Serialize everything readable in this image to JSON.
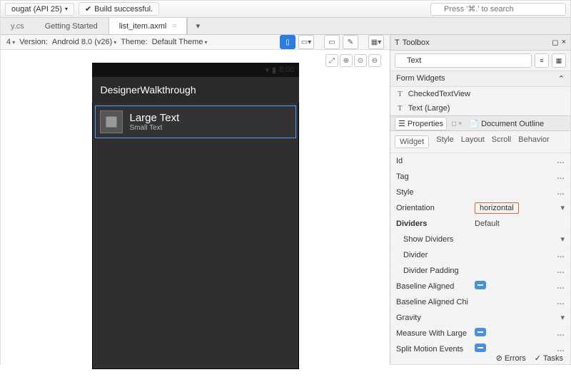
{
  "top": {
    "target": "ougat (API 25)",
    "build": "Build successful.",
    "search_ph": "Press '⌘.' to search"
  },
  "tabs": {
    "file0": "y.cs",
    "file1": "Getting Started",
    "file2": "list_item.axml"
  },
  "toolbar": {
    "seg0": "4",
    "version_lbl": "Version:",
    "version": "Android 8.0 (v26)",
    "theme_lbl": "Theme:",
    "theme": "Default Theme"
  },
  "device": {
    "time": "8:00",
    "app": "DesignerWalkthrough",
    "large": "Large Text",
    "small": "Small Text"
  },
  "toolbox": {
    "title": "Toolbox",
    "query": "Text",
    "cat": "Form Widgets",
    "items": [
      "CheckedTextView",
      "Text (Large)"
    ]
  },
  "props": {
    "title": "Properties",
    "outline": "Document Outline",
    "tabs": [
      "Widget",
      "Style",
      "Layout",
      "Scroll",
      "Behavior"
    ],
    "rows": [
      {
        "k": "Id",
        "v": "",
        "a": "dots"
      },
      {
        "k": "Tag",
        "v": "",
        "a": "dots"
      },
      {
        "k": "Style",
        "v": "",
        "a": "dots"
      },
      {
        "k": "Orientation",
        "v": "horizontal",
        "a": "dd",
        "hl": true
      },
      {
        "k": "Dividers",
        "v": "Default",
        "a": "",
        "bold": true
      },
      {
        "k": "Show Dividers",
        "v": "",
        "a": "dd",
        "ind": true
      },
      {
        "k": "Divider",
        "v": "",
        "a": "dots",
        "ind": true
      },
      {
        "k": "Divider Padding",
        "v": "",
        "a": "dots",
        "ind": true
      },
      {
        "k": "Baseline Aligned",
        "v": "toggle",
        "a": "dots"
      },
      {
        "k": "Baseline Aligned Chi",
        "v": "",
        "a": "dots"
      },
      {
        "k": "Gravity",
        "v": "",
        "a": "dd"
      },
      {
        "k": "Measure With Large",
        "v": "toggle",
        "a": "dots"
      },
      {
        "k": "Split Motion Events",
        "v": "toggle",
        "a": "dots"
      }
    ]
  },
  "footer": {
    "errors": "Errors",
    "tasks": "Tasks"
  }
}
